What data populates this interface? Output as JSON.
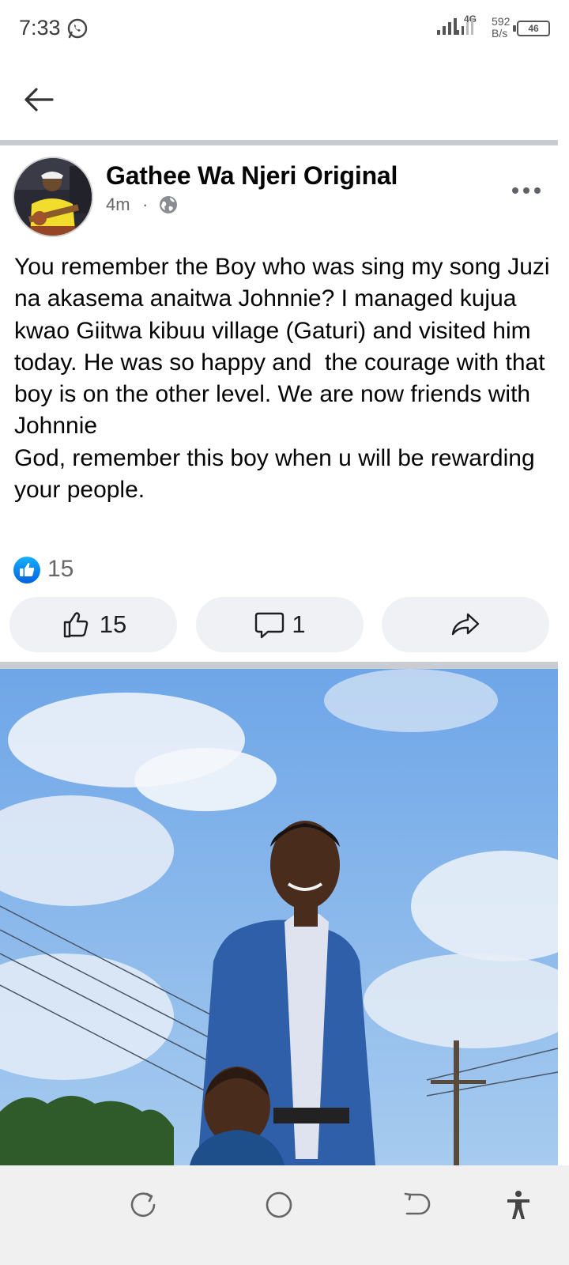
{
  "status_bar": {
    "time": "7:33",
    "network_type": "4G",
    "speed_value": "592",
    "speed_unit": "B/s",
    "battery": "46",
    "icons": [
      "whatsapp-icon",
      "signal-icon",
      "signal-icon",
      "battery-icon"
    ]
  },
  "app_bar": {
    "back_icon": "arrow-left-icon"
  },
  "post": {
    "author": "Gathee Wa Njeri Original",
    "time": "4m",
    "separator": "·",
    "privacy_icon": "globe-icon",
    "text": "You remember the Boy who was sing my song Juzi na akasema anaitwa Johnnie? I managed kujua kwao Giitwa kibuu village (Gaturi) and visited him today. He was so happy and  the courage with that boy is on the other level. We are now friends with Johnnie\nGod, remember this boy when u will be rewarding your people.",
    "reaction_count": "15",
    "actions": {
      "like_count": "15",
      "comment_count": "1"
    }
  },
  "nav_bar": {
    "icons": [
      "rotate-icon",
      "home-circle-icon",
      "back-icon",
      "accessibility-icon"
    ]
  },
  "colors": {
    "accent_blue": "#1877f2",
    "action_bg": "#eff1f4",
    "divider": "#c9ccd1",
    "muted_text": "#65676b"
  }
}
